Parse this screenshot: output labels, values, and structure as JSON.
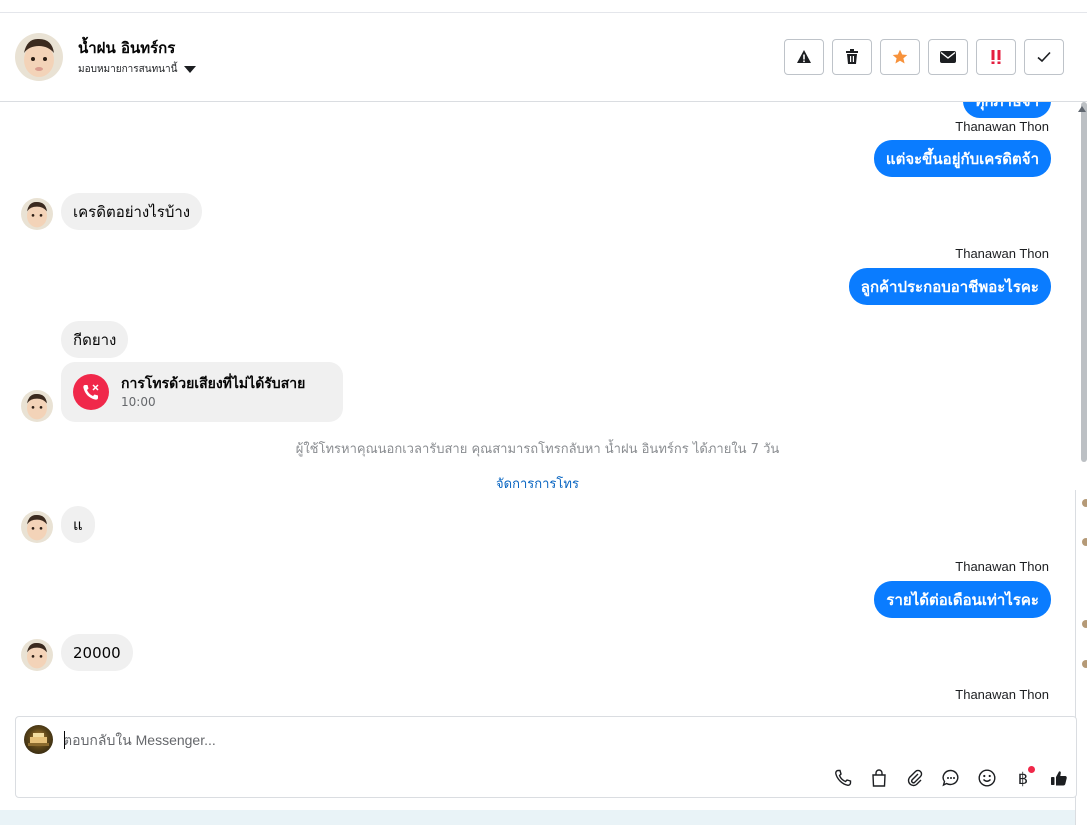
{
  "header": {
    "contact_name": "น้ำฝน อินทร์กร",
    "assign_label": "มอบหมายการสนทนานี้",
    "actions": [
      {
        "name": "spam-button",
        "icon": "warning-icon"
      },
      {
        "name": "delete-button",
        "icon": "trash-icon"
      },
      {
        "name": "star-button",
        "icon": "star-icon"
      },
      {
        "name": "mark-unread-button",
        "icon": "envelope-icon"
      },
      {
        "name": "priority-button",
        "icon": "double-exclamation-icon"
      },
      {
        "name": "mark-done-button",
        "icon": "check-icon"
      }
    ]
  },
  "thread": {
    "partial_top_text": "ทุกภาษีจ้า",
    "sender_name": "Thanawan Thon",
    "msg_credit_out": "แต่จะขึ้นอยู่กับเครดิตจ้า",
    "msg_credit_in": "เครดิตอย่างไรบ้าง",
    "msg_job_out": "ลูกค้าประกอบอาชีพอะไรคะ",
    "msg_rubber_in": "กีดยาง",
    "call": {
      "title": "การโทรด้วยเสียงที่ไม่ได้รับสาย",
      "time": "10:00"
    },
    "call_notice": "ผู้ใช้โทรหาคุณนอกเวลารับสาย คุณสามารถโทรกลับหา น้ำฝน อินทร์กร ได้ภายใน 7 วัน",
    "manage_calls": "จัดการการโทร",
    "msg_a_in": "แ",
    "msg_income_out": "รายได้ต่อเดือนเท่าไรคะ",
    "msg_20000_in": "20000"
  },
  "composer": {
    "placeholder": "ตอบกลับใน Messenger...",
    "value": "",
    "tools": [
      "phone-icon",
      "shopping-bag-icon",
      "paperclip-icon",
      "chat-bubble-icon",
      "emoji-icon",
      "baht-icon",
      "thumbs-up-icon"
    ]
  },
  "colors": {
    "outgoing_bubble": "#0a7cff",
    "incoming_bubble": "#f0f0f0",
    "missed_call": "#f0284a",
    "link": "#0a66c2"
  }
}
